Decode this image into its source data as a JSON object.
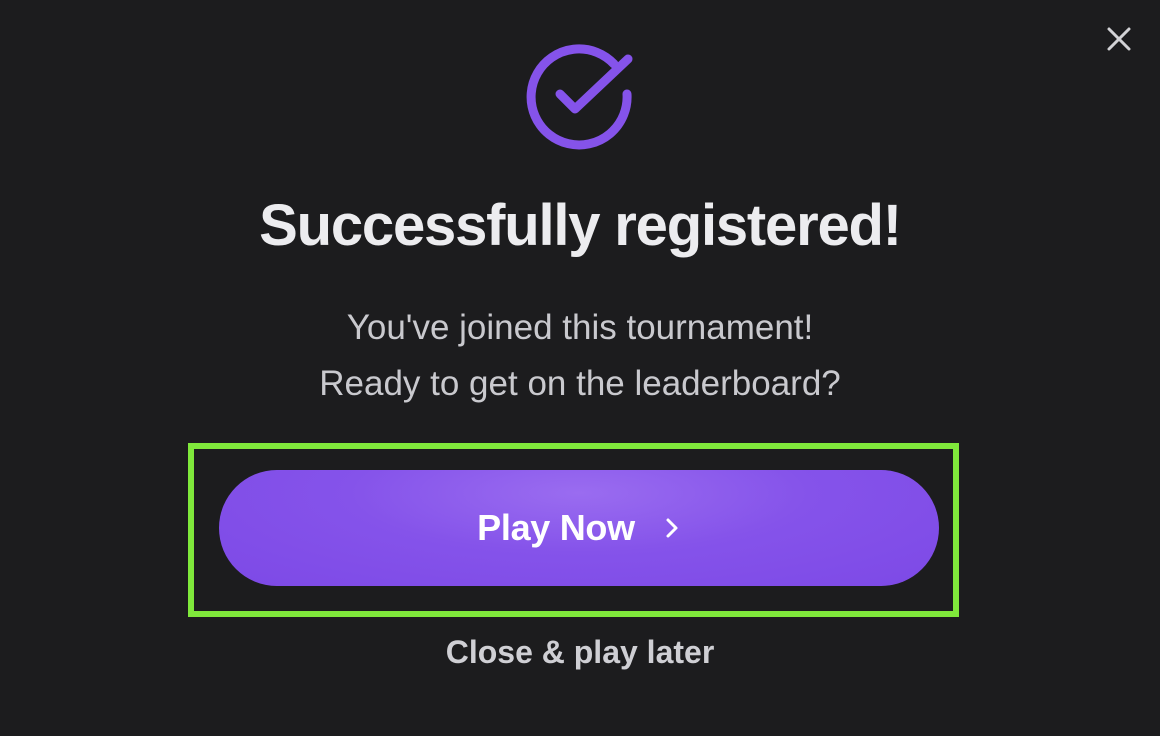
{
  "modal": {
    "title": "Successfully registered!",
    "message_line1": "You've joined this tournament!",
    "message_line2": "Ready to get on the leaderboard?",
    "primary_button_label": "Play Now",
    "secondary_link_label": "Close & play later"
  },
  "icons": {
    "success": "check-circle-icon",
    "close": "close-icon",
    "chevron": "chevron-right-icon"
  },
  "colors": {
    "background": "#1c1c1e",
    "accent": "#8553ea",
    "highlight": "#7fe83b",
    "title": "#ececef",
    "message": "#c9c9ce"
  }
}
